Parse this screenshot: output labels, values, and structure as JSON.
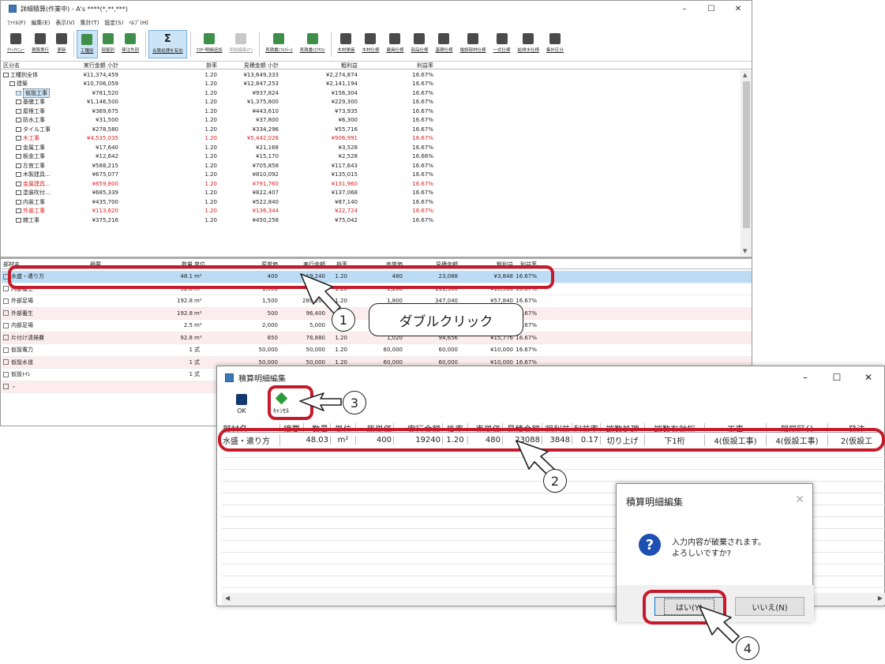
{
  "main": {
    "title": "詳細積算(作業中) - A's ****(*,**,***)",
    "menu": [
      "ﾌｧｲﾙ(F)",
      "編集(E)",
      "表示(V)",
      "集計(T)",
      "設定(S)",
      "ﾍﾙﾌﾟ(H)"
    ],
    "toolbar": [
      {
        "label": "ｸｲｯｸﾒﾆｭｰ",
        "icon": "menu-icon"
      },
      {
        "label": "積算実行",
        "icon": "run-icon"
      },
      {
        "label": "更新",
        "icon": "refresh-icon"
      },
      {
        "label": "工種別",
        "icon": "category-icon",
        "active": true
      },
      {
        "label": "部屋別",
        "icon": "room-icon"
      },
      {
        "label": "発注先別",
        "icon": "supplier-icon"
      },
      {
        "label": "合算処理を有効",
        "icon": "sigma-icon",
        "active": true
      },
      {
        "label": "ﾏｽﾀｰ明細追加",
        "icon": "add-icon"
      },
      {
        "label": "明細編集(F)",
        "icon": "edit-icon",
        "disabled": true
      },
      {
        "label": "見積書(ﾌﾙｽﾃｨ)",
        "icon": "quote-icon"
      },
      {
        "label": "見積書(ｴｸｾﾙ)",
        "icon": "excel-icon"
      },
      {
        "label": "木材単価",
        "icon": "wood-price-icon"
      },
      {
        "label": "木材仕様",
        "icon": "wood-spec-icon"
      },
      {
        "label": "建具仕様",
        "icon": "fitting-icon"
      },
      {
        "label": "部品仕様",
        "icon": "parts-icon"
      },
      {
        "label": "基礎仕様",
        "icon": "foundation-icon"
      },
      {
        "label": "電設部材仕様",
        "icon": "electric-icon"
      },
      {
        "label": "一式仕様",
        "icon": "set-icon"
      },
      {
        "label": "給排水仕様",
        "icon": "plumbing-icon"
      },
      {
        "label": "集計区分",
        "icon": "tally-icon"
      }
    ],
    "upper_headers": [
      "区分名",
      "実行金額 小計",
      "掛率",
      "見積金額 小計",
      "粗利益",
      "利益率"
    ],
    "upper_rows": [
      {
        "name": "工種別全体",
        "exec": "¥11,374,459",
        "rate": "1.20",
        "est": "¥13,649,333",
        "profit": "¥2,274,874",
        "ratio": "16.67%",
        "indent": 0
      },
      {
        "name": "建築",
        "exec": "¥10,706,059",
        "rate": "1.20",
        "est": "¥12,847,253",
        "profit": "¥2,141,194",
        "ratio": "16.67%",
        "indent": 1
      },
      {
        "name": "仮設工事",
        "exec": "¥781,520",
        "rate": "1.20",
        "est": "¥937,824",
        "profit": "¥156,304",
        "ratio": "16.67%",
        "indent": 2,
        "selected": true
      },
      {
        "name": "基礎工事",
        "exec": "¥1,146,500",
        "rate": "1.20",
        "est": "¥1,375,800",
        "profit": "¥229,300",
        "ratio": "16.67%",
        "indent": 2
      },
      {
        "name": "屋根工事",
        "exec": "¥369,675",
        "rate": "1.20",
        "est": "¥443,610",
        "profit": "¥73,935",
        "ratio": "16.67%",
        "indent": 2
      },
      {
        "name": "防水工事",
        "exec": "¥31,500",
        "rate": "1.20",
        "est": "¥37,800",
        "profit": "¥6,300",
        "ratio": "16.67%",
        "indent": 2
      },
      {
        "name": "タイル工事",
        "exec": "¥278,580",
        "rate": "1.20",
        "est": "¥334,296",
        "profit": "¥55,716",
        "ratio": "16.67%",
        "indent": 2
      },
      {
        "name": "木工事",
        "exec": "¥4,535,035",
        "rate": "1.20",
        "est": "¥5,442,026",
        "profit": "¥906,991",
        "ratio": "16.67%",
        "indent": 2,
        "red": true
      },
      {
        "name": "金属工事",
        "exec": "¥17,640",
        "rate": "1.20",
        "est": "¥21,168",
        "profit": "¥3,528",
        "ratio": "16.67%",
        "indent": 2
      },
      {
        "name": "板金工事",
        "exec": "¥12,642",
        "rate": "1.20",
        "est": "¥15,170",
        "profit": "¥2,528",
        "ratio": "16.66%",
        "indent": 2
      },
      {
        "name": "左官工事",
        "exec": "¥588,215",
        "rate": "1.20",
        "est": "¥705,858",
        "profit": "¥117,643",
        "ratio": "16.67%",
        "indent": 2
      },
      {
        "name": "木製建具...",
        "exec": "¥675,077",
        "rate": "1.20",
        "est": "¥810,092",
        "profit": "¥135,015",
        "ratio": "16.67%",
        "indent": 2
      },
      {
        "name": "金属建具...",
        "exec": "¥659,800",
        "rate": "1.20",
        "est": "¥791,760",
        "profit": "¥131,960",
        "ratio": "16.67%",
        "indent": 2,
        "red": true
      },
      {
        "name": "塗装吹付...",
        "exec": "¥685,339",
        "rate": "1.20",
        "est": "¥822,407",
        "profit": "¥137,068",
        "ratio": "16.67%",
        "indent": 2
      },
      {
        "name": "内装工事",
        "exec": "¥435,700",
        "rate": "1.20",
        "est": "¥522,840",
        "profit": "¥87,140",
        "ratio": "16.67%",
        "indent": 2
      },
      {
        "name": "外装工事",
        "exec": "¥113,620",
        "rate": "1.20",
        "est": "¥136,344",
        "profit": "¥22,724",
        "ratio": "16.67%",
        "indent": 2,
        "red": true
      },
      {
        "name": "雑工事",
        "exec": "¥375,216",
        "rate": "1.20",
        "est": "¥450,258",
        "profit": "¥75,042",
        "ratio": "16.67%",
        "indent": 2
      }
    ],
    "lower_headers": [
      "部材名",
      "摘要",
      "数量",
      "単位",
      "原単価",
      "実行金額",
      "掛率",
      "売単価",
      "見積金額",
      "粗利益",
      "利益率"
    ],
    "lower_rows": [
      {
        "name": "水盛・遣り方",
        "qty": "48.1",
        "unit": "m²",
        "cost": "400",
        "exec": "19,240",
        "rate": "1.20",
        "sell": "480",
        "est": "23,088",
        "profit": "¥3,848",
        "ratio": "16.67%",
        "hl": true
      },
      {
        "name": "内部養生",
        "qty": "92.8",
        "unit": "m²",
        "cost": "1,000",
        "exec": "92,800",
        "rate": "1.20",
        "sell": "1,200",
        "est": "111,360",
        "profit": "¥18,560",
        "ratio": "16.67%"
      },
      {
        "name": "外部足場",
        "qty": "192.8",
        "unit": "m²",
        "cost": "1,500",
        "exec": "289,200",
        "rate": "1.20",
        "sell": "1,800",
        "est": "347,040",
        "profit": "¥57,840",
        "ratio": "16.67%"
      },
      {
        "name": "外部養生",
        "qty": "192.8",
        "unit": "m²",
        "cost": "500",
        "exec": "96,400",
        "rate": "1.20",
        "sell": "600",
        "est": "115,680",
        "profit": "¥19,280",
        "ratio": "16.67%",
        "alt": true
      },
      {
        "name": "内部足場",
        "qty": "2.5",
        "unit": "m²",
        "cost": "2,000",
        "exec": "5,000",
        "rate": "1.20",
        "sell": "2,400",
        "est": "6,000",
        "profit": "¥1,000",
        "ratio": "16.67%"
      },
      {
        "name": "片付け清掃費",
        "qty": "92.8",
        "unit": "m²",
        "cost": "850",
        "exec": "78,880",
        "rate": "1.20",
        "sell": "1,020",
        "est": "94,656",
        "profit": "¥15,776",
        "ratio": "16.67%",
        "alt": true
      },
      {
        "name": "仮設電力",
        "qty": "1",
        "unit": "式",
        "cost": "50,000",
        "exec": "50,000",
        "rate": "1.20",
        "sell": "60,000",
        "est": "60,000",
        "profit": "¥10,000",
        "ratio": "16.67%"
      },
      {
        "name": "仮設水道",
        "qty": "1",
        "unit": "式",
        "cost": "50,000",
        "exec": "50,000",
        "rate": "1.20",
        "sell": "60,000",
        "est": "60,000",
        "profit": "¥10,000",
        "ratio": "16.67%",
        "alt": true
      },
      {
        "name": "仮設ﾄｲﾚ",
        "qty": "1",
        "unit": "式",
        "cost": "",
        "exec": "",
        "rate": "",
        "sell": "",
        "est": "",
        "profit": "",
        "ratio": ""
      },
      {
        "name": "・",
        "qty": "",
        "unit": "",
        "cost": "",
        "exec": "",
        "rate": "",
        "sell": "",
        "est": "",
        "profit": "",
        "ratio": "",
        "alt": true
      }
    ]
  },
  "callouts": {
    "step1_num": "1",
    "step1_text": "ダブルクリック",
    "step2_num": "2",
    "step3_num": "3",
    "step4_num": "4"
  },
  "detail_dialog": {
    "title": "積算明細編集",
    "ok_label": "OK",
    "cancel_label": "ｷｬﾝｾﾙ",
    "headers": [
      "部材名",
      "摘要",
      "数量",
      "単位",
      "原単価",
      "実行金額",
      "掛率",
      "売単価",
      "見積金額",
      "粗利益",
      "利益率",
      "端数処理",
      "端数有効桁",
      "工事",
      "部屋区分",
      "発注"
    ],
    "row": [
      "水盛・遣り方",
      "",
      "48.03",
      "m²",
      "400",
      "19240",
      "1.20",
      "480",
      "23088",
      "3848",
      "0.17",
      "切り上げ",
      "下1桁",
      "4(仮設工事)",
      "4(仮設工事)",
      "2(仮設工"
    ]
  },
  "confirm_dialog": {
    "title": "積算明細編集",
    "message_line1": "入力内容が破棄されます。",
    "message_line2": "よろしいですか?",
    "yes_label": "はい(Y)",
    "no_label": "いいえ(N)"
  },
  "colors": {
    "highlight": "#c61a2a",
    "selection": "#bcdcf5",
    "red_text": "#e02020"
  }
}
